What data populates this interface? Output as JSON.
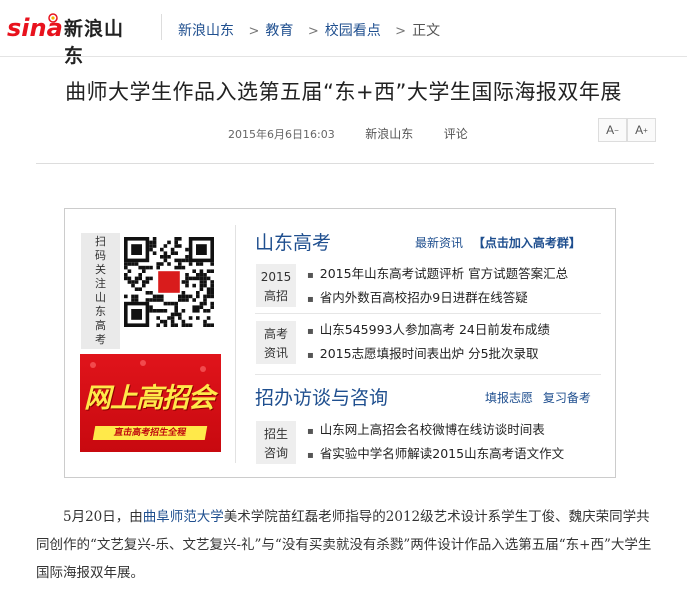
{
  "header": {
    "logo_text": "新浪山东",
    "breadcrumbs": [
      "新浪山东",
      "教育",
      "校园看点"
    ],
    "current": "正文"
  },
  "article": {
    "title": "曲师大学生作品入选第五届“东+西”大学生国际海报双年展",
    "datetime": "2015年6月6日16:03",
    "source": "新浪山东",
    "comment_label": "评论",
    "font_smaller": "A",
    "font_larger": "A",
    "para_start": "5月20日，由",
    "para_link": "曲阜师范大学",
    "para_rest": "美术学院苗红磊老师指导的2012级艺术设计系学生丁俊、魏庆荣同学共同创作的“文艺复兴-乐、文艺复兴-礼”与“没有买卖就没有杀戮”两件设计作品入选第五届“东+西”大学生国际海报双年展。"
  },
  "promo": {
    "scan_text": "扫码关注山东高考",
    "banner_big": "网上高招会",
    "banner_small": "直击高考招生全程",
    "section1": {
      "title": "山东高考",
      "link1": "最新资讯",
      "link2": "【点击加入高考群】",
      "groups": [
        {
          "tag": [
            "2015",
            "高招"
          ],
          "items": [
            "2015年山东高考试题评析 官方试题答案汇总",
            "省内外数百高校招办9日进群在线答疑"
          ]
        },
        {
          "tag": [
            "高考",
            "资讯"
          ],
          "items": [
            "山东545993人参加高考 24日前发布成绩",
            "2015志愿填报时间表出炉 分5批次录取"
          ]
        }
      ]
    },
    "section2": {
      "title": "招办访谈与咨询",
      "link1": "填报志愿",
      "link2": "复习备考",
      "groups": [
        {
          "tag": [
            "招生",
            "咨询"
          ],
          "items": [
            "山东网上高招会名校微博在线访谈时间表",
            "省实验中学名师解读2015山东高考语文作文"
          ]
        }
      ]
    }
  },
  "colors": {
    "link": "#1f4f8f",
    "accent_red": "#c00000",
    "logo_red": "#e8121d"
  }
}
